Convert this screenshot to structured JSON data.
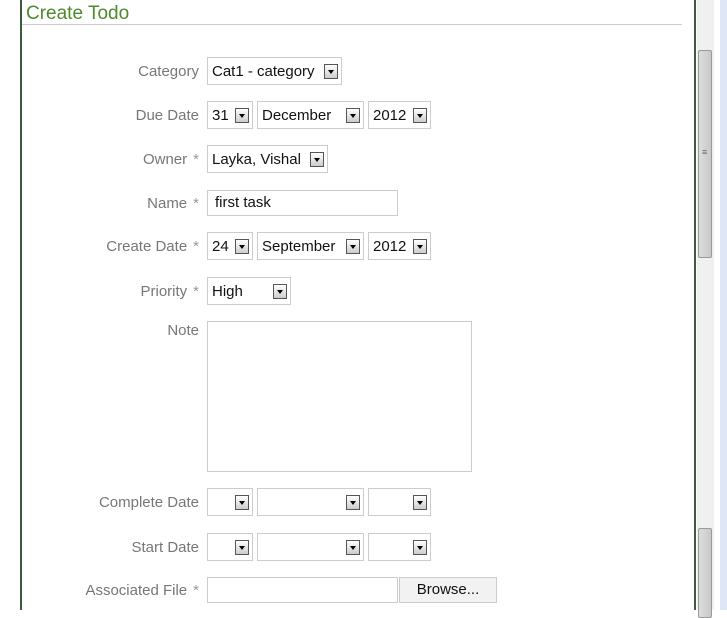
{
  "title": "Create Todo",
  "fields": {
    "category": {
      "label": "Category",
      "value": "Cat1 - category"
    },
    "due_date": {
      "label": "Due Date",
      "day": "31",
      "month": "December",
      "year": "2012"
    },
    "owner": {
      "label": "Owner",
      "value": "Layka, Vishal"
    },
    "name": {
      "label": "Name",
      "value": "first task"
    },
    "create_date": {
      "label": "Create Date",
      "day": "24",
      "month": "September",
      "year": "2012"
    },
    "priority": {
      "label": "Priority",
      "value": "High"
    },
    "note": {
      "label": "Note",
      "value": ""
    },
    "complete_date": {
      "label": "Complete Date"
    },
    "start_date": {
      "label": "Start Date"
    },
    "associated_file": {
      "label": "Associated File",
      "browse": "Browse..."
    }
  },
  "required_marker": "*"
}
